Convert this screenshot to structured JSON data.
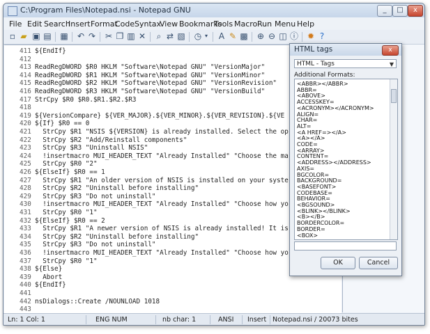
{
  "window": {
    "title": "C:\\Program Files\\Notepad.nsi - Notepad GNU"
  },
  "menu": [
    "File",
    "Edit",
    "Search",
    "Insert",
    "Format",
    "Code",
    "Syntax",
    "View",
    "Bookmarks",
    "Tools",
    "Macro",
    "Run",
    "Menu",
    "Help"
  ],
  "code_lines": [
    {
      "n": "411",
      "t": "${EndIf}"
    },
    {
      "n": "412",
      "t": ""
    },
    {
      "n": "413",
      "t": "ReadRegDWORD $R0 HKLM \"Software\\Notepad GNU\" \"VersionMajor\""
    },
    {
      "n": "414",
      "t": "ReadRegDWORD $R1 HKLM \"Software\\Notepad GNU\" \"VersionMinor\""
    },
    {
      "n": "415",
      "t": "ReadRegDWORD $R2 HKLM \"Software\\Notepad GNU\" \"VersionRevision\""
    },
    {
      "n": "416",
      "t": "ReadRegDWORD $R3 HKLM \"Software\\Notepad GNU\" \"VersionBuild\""
    },
    {
      "n": "417",
      "t": "StrCpy $R0 $R0.$R1.$R2.$R3"
    },
    {
      "n": "418",
      "t": ""
    },
    {
      "n": "419",
      "t": "${VersionCompare} ${VER_MAJOR}.${VER_MINOR}.${VER_REVISION}.${VE"
    },
    {
      "n": "420",
      "t": "${If} $R0 == 0"
    },
    {
      "n": "421",
      "t": "  StrCpy $R1 \"NSIS ${VERSION} is already installed. Select the op"
    },
    {
      "n": "422",
      "t": "  StrCpy $R2 \"Add/Reinstall components\""
    },
    {
      "n": "423",
      "t": "  StrCpy $R3 \"Uninstall NSIS\""
    },
    {
      "n": "424",
      "t": "  !insertmacro MUI_HEADER_TEXT \"Already Installed\" \"Choose the ma"
    },
    {
      "n": "425",
      "t": "  StrCpy $R0 \"2\""
    },
    {
      "n": "426",
      "t": "${ElseIf} $R0 == 1"
    },
    {
      "n": "427",
      "t": "  StrCpy $R1 \"An older version of NSIS is installed on your syste"
    },
    {
      "n": "428",
      "t": "  StrCpy $R2 \"Uninstall before installing\""
    },
    {
      "n": "429",
      "t": "  StrCpy $R3 \"Do not uninstall\""
    },
    {
      "n": "430",
      "t": "  !insertmacro MUI_HEADER_TEXT \"Already Installed\" \"Choose how yo"
    },
    {
      "n": "431",
      "t": "  StrCpy $R0 \"1\""
    },
    {
      "n": "432",
      "t": "${ElseIf} $R0 == 2"
    },
    {
      "n": "433",
      "t": "  StrCpy $R1 \"A newer version of NSIS is already installed! It is"
    },
    {
      "n": "434",
      "t": "  StrCpy $R2 \"Uninstall before installing\""
    },
    {
      "n": "435",
      "t": "  StrCpy $R3 \"Do not uninstall\""
    },
    {
      "n": "436",
      "t": "  !insertmacro MUI_HEADER_TEXT \"Already Installed\" \"Choose how yo"
    },
    {
      "n": "437",
      "t": "  StrCpy $R0 \"1\""
    },
    {
      "n": "438",
      "t": "${Else}"
    },
    {
      "n": "439",
      "t": "  Abort"
    },
    {
      "n": "440",
      "t": "${EndIf}"
    },
    {
      "n": "441",
      "t": ""
    },
    {
      "n": "442",
      "t": "nsDialogs::Create /NOUNLOAD 1018"
    },
    {
      "n": "443",
      "t": ""
    }
  ],
  "dialog": {
    "title": "HTML tags",
    "selected": "HTML - Tags",
    "label": "Additional Formats:",
    "items": [
      "<ABBR></ABBR>",
      "ABBR=",
      "<ABOVE>",
      "ACCESSKEY=",
      "<ACRONYM></ACRONYM>",
      "ALIGN=",
      "CHAR=",
      "ALT=",
      "<A HREF=></A>",
      "<A></A>",
      "CODE=",
      "<ARRAY>",
      "CONTENT=",
      "<ADDRESS></ADDRESS>",
      "AXIS=",
      "BGCOLOR=",
      "BACKGROUND=",
      "<BASEFONT>",
      "CODEBASE=",
      "BEHAVIOR=",
      "<BGSOUND>",
      "<BLINK></BLINK>",
      "<B></B>",
      "BORDERCOLOR=",
      "BORDER=",
      "<BOX>"
    ],
    "ok": "OK",
    "cancel": "Cancel"
  },
  "status": {
    "pos": "Ln: 1 Col: 1",
    "mode": "ENG  NUM",
    "nbchar": "nb char: 1",
    "encoding": "ANSI",
    "insert": "Insert",
    "file": "Notepad.nsi / 20073 bites"
  },
  "window_buttons": {
    "minimize": "_",
    "maximize": "□",
    "close": "x"
  }
}
